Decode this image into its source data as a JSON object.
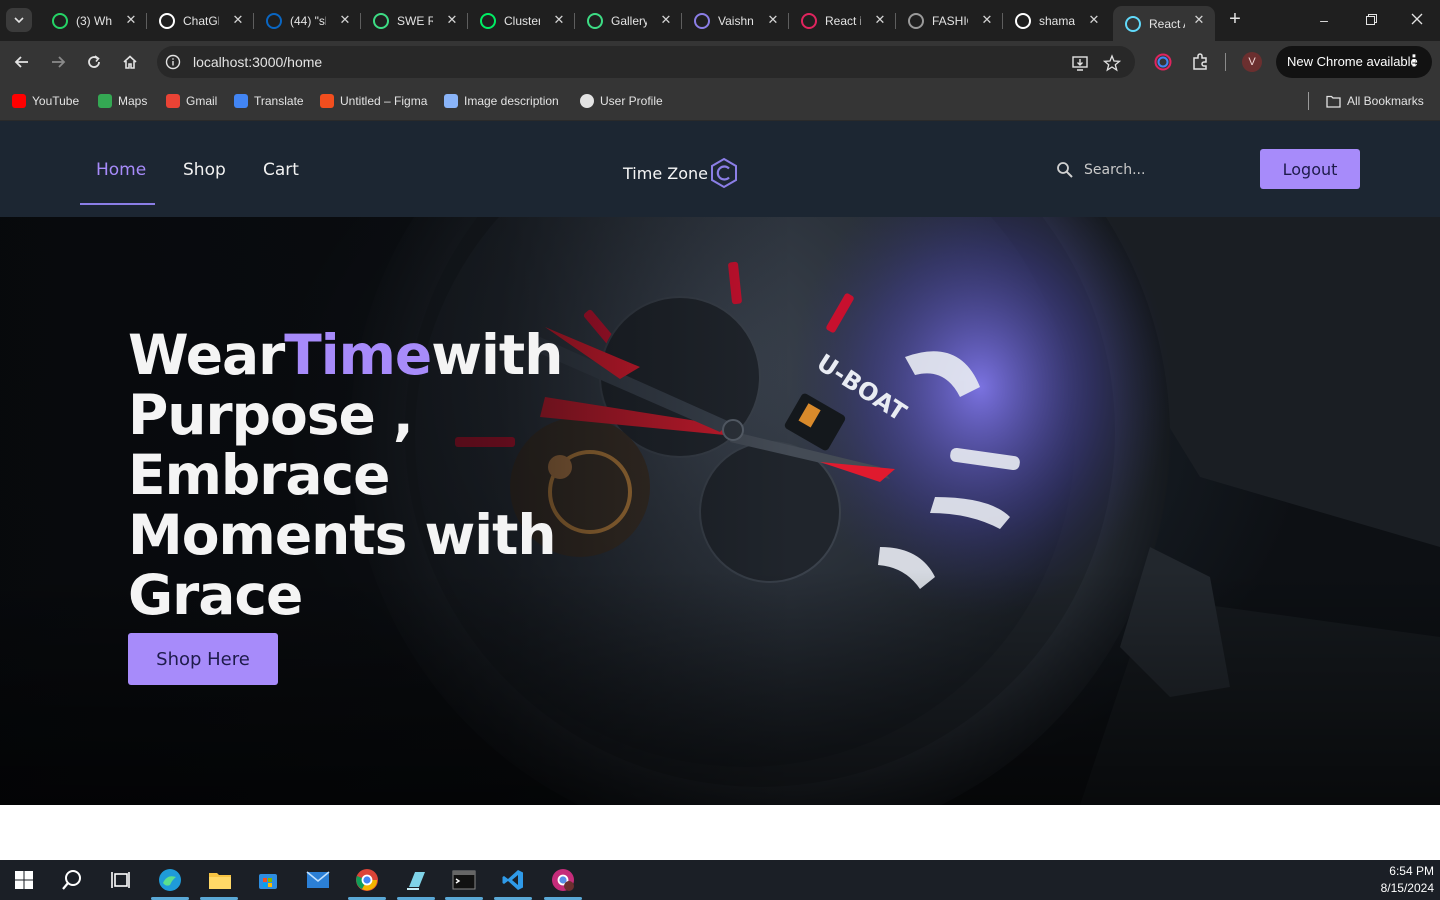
{
  "browser": {
    "tabs": [
      {
        "title": "(3) Wh",
        "icon": "whatsapp-icon",
        "color": "#25d366"
      },
      {
        "title": "ChatGF",
        "icon": "chatgpt-icon",
        "color": "#ffffff"
      },
      {
        "title": "(44) \"sl",
        "icon": "linkedin-icon",
        "color": "#0a66c2"
      },
      {
        "title": "SWE R",
        "icon": "leaf-icon",
        "color": "#3ddc84"
      },
      {
        "title": "Cluster",
        "icon": "mongodb-icon",
        "color": "#00ed64"
      },
      {
        "title": "Gallery",
        "icon": "leaf-icon",
        "color": "#3ddc84"
      },
      {
        "title": "Vaishn",
        "icon": "github-copilot-icon",
        "color": "#8b7ee6"
      },
      {
        "title": "React i",
        "icon": "react-icon",
        "color": "#e0245e"
      },
      {
        "title": "FASHIC",
        "icon": "loading-icon",
        "color": "#9a9a9a"
      },
      {
        "title": "shama",
        "icon": "github-icon",
        "color": "#ffffff"
      },
      {
        "title": "React A",
        "icon": "react-icon",
        "color": "#61dafb"
      }
    ],
    "url": "localhost:3000/home",
    "profile_initial": "V",
    "update_label": "New Chrome available",
    "bookmarks": [
      {
        "label": "YouTube",
        "icon": "youtube-icon",
        "color": "#ff0000"
      },
      {
        "label": "Maps",
        "icon": "maps-icon",
        "color": "#34a853"
      },
      {
        "label": "Gmail",
        "icon": "gmail-icon",
        "color": "#ea4335"
      },
      {
        "label": "Translate",
        "icon": "translate-icon",
        "color": "#4285f4"
      },
      {
        "label": "Untitled – Figma",
        "icon": "figma-icon",
        "color": "#f24e1e"
      },
      {
        "label": "Image description",
        "icon": "gear-icon",
        "color": "#8ab4f8"
      },
      {
        "label": "User Profile",
        "icon": "globe-icon",
        "color": "#e3e3e3"
      }
    ],
    "all_bookmarks": "All Bookmarks"
  },
  "site": {
    "nav": {
      "home": "Home",
      "shop": "Shop",
      "cart": "Cart"
    },
    "brand": "Time Zone",
    "search_placeholder": "Search...",
    "logout": "Logout",
    "hero": {
      "line1_a": "Wear",
      "line1_accent": "Time",
      "line1_b": "with",
      "line_rest": "Purpose , Embrace Moments with Grace",
      "cta": "Shop Here"
    },
    "accent_color": "#a78bfa",
    "header_bg": "#1c2632"
  },
  "taskbar": {
    "time": "6:54 PM",
    "date": "8/15/2024"
  }
}
